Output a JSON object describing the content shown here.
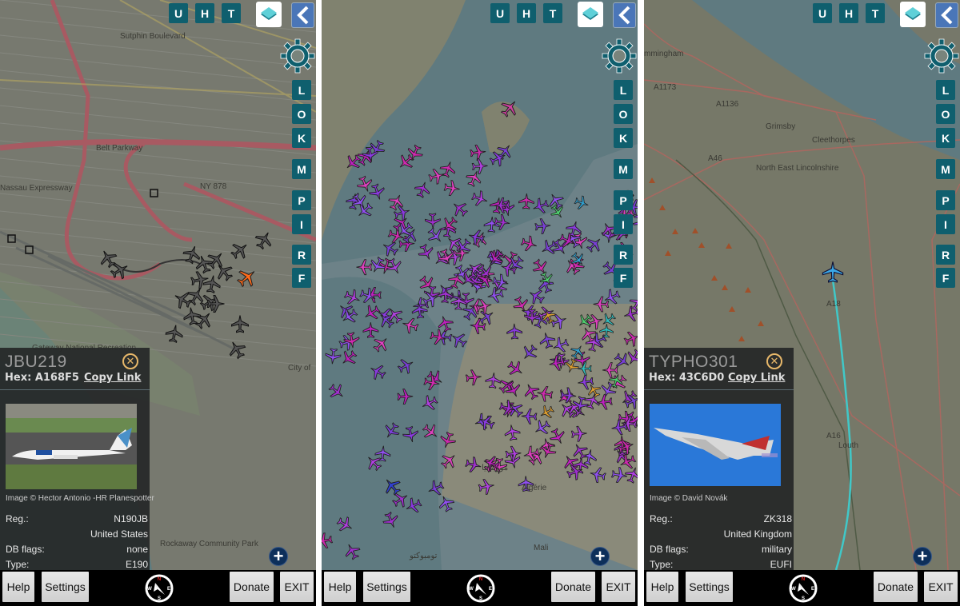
{
  "common": {
    "top_buttons": [
      "U",
      "H",
      "T"
    ],
    "side_buttons": [
      "L",
      "O",
      "K",
      "M",
      "P",
      "I",
      "R",
      "F"
    ],
    "layers_icon": "layers-icon",
    "back_icon": "chevron-left-icon",
    "settings_icon": "gear-icon",
    "zoom_in_label": "+",
    "bottom_bar": {
      "help": "Help",
      "settings": "Settings",
      "donate": "Donate",
      "exit": "EXIT"
    },
    "compass_icon": "compass-icon",
    "compass_letters": {
      "n": "N",
      "s": "S",
      "e": "E",
      "w": "W"
    },
    "colors": {
      "button": "#0f5f6e",
      "back": "#4a76b8",
      "close": "#e8b86a",
      "trail": "#40c8c8",
      "selected_plane_panel1": "#ff6a1a",
      "selected_plane_panel3": "#3aa8e8"
    }
  },
  "panels": [
    {
      "map_labels": [
        "Sutphin Boulevard",
        "Belt Parkway",
        "NY 878",
        "Nassau Expressway",
        "Gateway National Recreation",
        "Rockaway Community Park",
        "City of"
      ],
      "popup": {
        "callsign": "JBU219",
        "hex_label": "Hex:",
        "hex": "A168F5",
        "copy_link": "Copy Link",
        "image_caption": "Image © Hector Antonio -HR Planespotter",
        "rows": [
          {
            "label": "Reg.:",
            "value": "N190JB"
          },
          {
            "label": "",
            "value": "United States"
          },
          {
            "label": "DB flags:",
            "value": "none"
          },
          {
            "label": "Type:",
            "value": "E190"
          }
        ]
      }
    },
    {
      "map_labels": [
        "Algérie",
        "Mali",
        "موريتانيا",
        "تومبوكتو"
      ]
    },
    {
      "map_labels": [
        "mmingham",
        "A1173",
        "A1136",
        "Grimsby",
        "Cleethorpes",
        "A46",
        "North East Lincolnshire",
        "A18",
        "A16",
        "Louth"
      ],
      "popup": {
        "callsign": "TYPHO301",
        "hex_label": "Hex:",
        "hex": "43C6D0",
        "copy_link": "Copy Link",
        "image_caption": "Image © David Novák",
        "rows": [
          {
            "label": "Reg.:",
            "value": "ZK318"
          },
          {
            "label": "",
            "value": "United Kingdom"
          },
          {
            "label": "DB flags:",
            "value": "military"
          },
          {
            "label": "Type:",
            "value": "EUFI"
          }
        ]
      }
    }
  ]
}
